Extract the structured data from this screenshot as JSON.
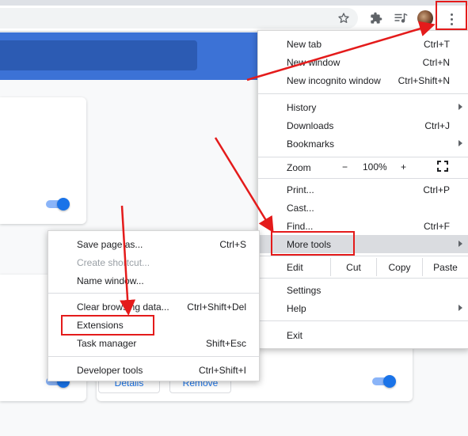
{
  "toolbar": {
    "icons": [
      "star-icon",
      "extensions-puzzle-icon",
      "media-playlist-icon",
      "avatar",
      "kebab-menu-icon"
    ]
  },
  "main_menu": {
    "items": [
      {
        "label": "New tab",
        "shortcut": "Ctrl+T"
      },
      {
        "label": "New window",
        "shortcut": "Ctrl+N"
      },
      {
        "label": "New incognito window",
        "shortcut": "Ctrl+Shift+N"
      },
      {
        "label": "History",
        "submenu": true
      },
      {
        "label": "Downloads",
        "shortcut": "Ctrl+J"
      },
      {
        "label": "Bookmarks",
        "submenu": true
      },
      {
        "label": "Zoom"
      },
      {
        "label": "Print...",
        "shortcut": "Ctrl+P"
      },
      {
        "label": "Cast..."
      },
      {
        "label": "Find...",
        "shortcut": "Ctrl+F"
      },
      {
        "label": "More tools",
        "submenu": true
      },
      {
        "label": "Edit"
      },
      {
        "label": "Settings"
      },
      {
        "label": "Help",
        "submenu": true
      },
      {
        "label": "Exit"
      }
    ],
    "zoom": {
      "minus": "−",
      "value": "100%",
      "plus": "+"
    },
    "edit": {
      "cut": "Cut",
      "copy": "Copy",
      "paste": "Paste"
    }
  },
  "submenu": {
    "items": [
      {
        "label": "Save page as...",
        "shortcut": "Ctrl+S"
      },
      {
        "label": "Create shortcut...",
        "disabled": true
      },
      {
        "label": "Name window..."
      },
      {
        "label": "Clear browsing data...",
        "shortcut": "Ctrl+Shift+Del"
      },
      {
        "label": "Extensions"
      },
      {
        "label": "Task manager",
        "shortcut": "Shift+Esc"
      },
      {
        "label": "Developer tools",
        "shortcut": "Ctrl+Shift+I"
      }
    ]
  },
  "page": {
    "card_buttons": {
      "details": "Details",
      "remove": "Remove"
    }
  },
  "colors": {
    "accent": "#1a73e8",
    "banner": "#3c72d6",
    "annotation": "#e41b1b"
  }
}
